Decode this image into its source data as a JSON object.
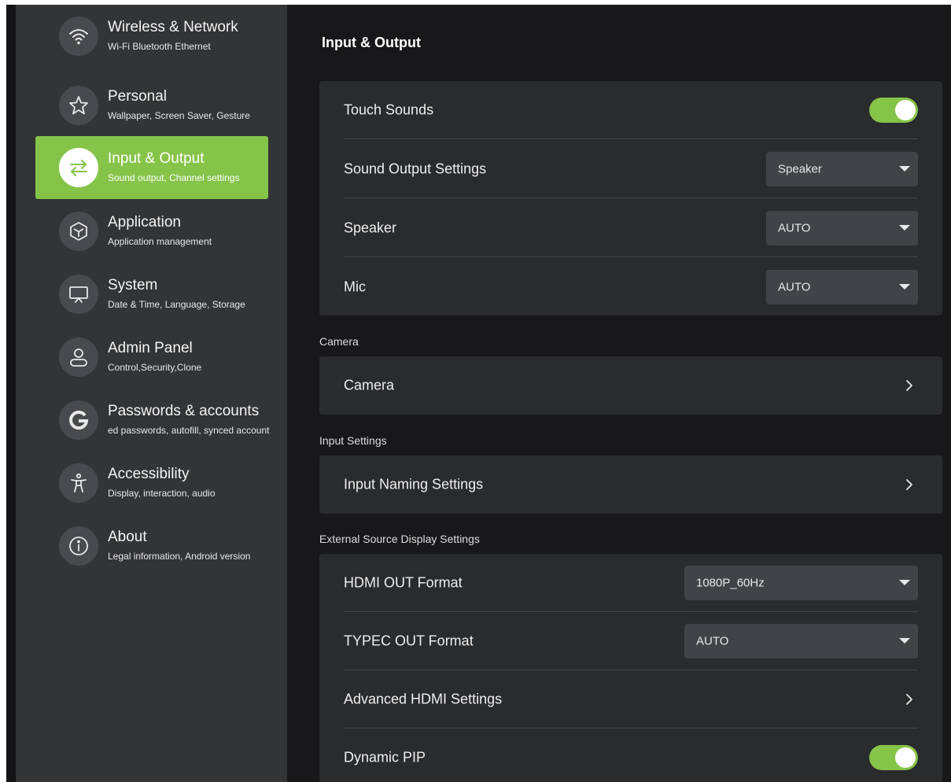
{
  "sidebar": {
    "items": [
      {
        "icon": "wifi-icon",
        "title": "Wireless & Network",
        "subtitle": "Wi-Fi Bluetooth Ethernet",
        "active": false
      },
      {
        "icon": "star-icon",
        "title": "Personal",
        "subtitle": "Wallpaper, Screen Saver, Gesture",
        "active": false
      },
      {
        "icon": "swap-arrows-icon",
        "title": "Input & Output",
        "subtitle": "Sound output, Channel settings",
        "active": true
      },
      {
        "icon": "cube-icon",
        "title": "Application",
        "subtitle": "Application management",
        "active": false
      },
      {
        "icon": "monitor-icon",
        "title": "System",
        "subtitle": "Date & Time, Language, Storage",
        "active": false
      },
      {
        "icon": "person-icon",
        "title": "Admin Panel",
        "subtitle": "Control,Security,Clone",
        "active": false
      },
      {
        "icon": "google-icon",
        "title": "Passwords & accounts",
        "subtitle": "ed passwords, autofill, synced account",
        "active": false
      },
      {
        "icon": "accessibility-icon",
        "title": "Accessibility",
        "subtitle": "Display, interaction, audio",
        "active": false
      },
      {
        "icon": "info-icon",
        "title": "About",
        "subtitle": "Legal information, Android version",
        "active": false
      }
    ]
  },
  "main": {
    "title": "Input & Output",
    "audio": {
      "touch_sounds": {
        "label": "Touch Sounds",
        "enabled": true
      },
      "sound_output": {
        "label": "Sound Output Settings",
        "value": "Speaker"
      },
      "speaker": {
        "label": "Speaker",
        "value": "AUTO"
      },
      "mic": {
        "label": "Mic",
        "value": "AUTO"
      }
    },
    "camera": {
      "section": "Camera",
      "item": "Camera"
    },
    "input": {
      "section": "Input Settings",
      "item": "Input Naming Settings"
    },
    "external": {
      "section": "External Source Display Settings",
      "hdmi_out": {
        "label": "HDMI OUT Format",
        "value": "1080P_60Hz"
      },
      "typec_out": {
        "label": "TYPEC OUT Format",
        "value": "AUTO"
      },
      "advanced_hdmi": {
        "label": "Advanced HDMI Settings"
      },
      "dynamic_pip": {
        "label": "Dynamic PIP",
        "enabled": true
      }
    }
  },
  "colors": {
    "accent": "#86c449",
    "background": "#18181b",
    "sidebar": "#333436",
    "card": "#2a2b2d"
  }
}
